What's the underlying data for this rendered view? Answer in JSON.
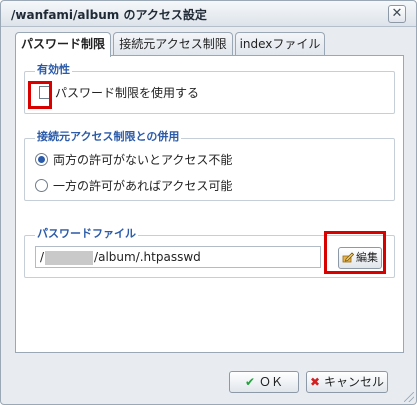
{
  "window": {
    "title": "/wanfami/album のアクセス設定",
    "close_glyph": "✕"
  },
  "tabs": [
    {
      "label": "パスワード制限",
      "active": true
    },
    {
      "label": "接続元アクセス制限",
      "active": false
    },
    {
      "label": "indexファイル",
      "active": false
    }
  ],
  "validity": {
    "legend": "有効性",
    "checkbox_label": "パスワード制限を使用する",
    "checked": false
  },
  "combined": {
    "legend": "接続元アクセス制限との併用",
    "options": [
      {
        "label": "両方の許可がないとアクセス不能",
        "checked": true
      },
      {
        "label": "一方の許可があればアクセス可能",
        "checked": false
      }
    ]
  },
  "password_file": {
    "legend": "パスワードファイル",
    "path_prefix": "/",
    "path_suffix": "/album/.htpasswd",
    "edit_label": "編集"
  },
  "footer": {
    "ok_label": "ＯＫ",
    "cancel_label": "キャンセル"
  },
  "colors": {
    "legend_text": "#2a5aa8",
    "highlight": "#d90000",
    "ok_icon": "#23a13d",
    "cancel_icon": "#d32020"
  }
}
